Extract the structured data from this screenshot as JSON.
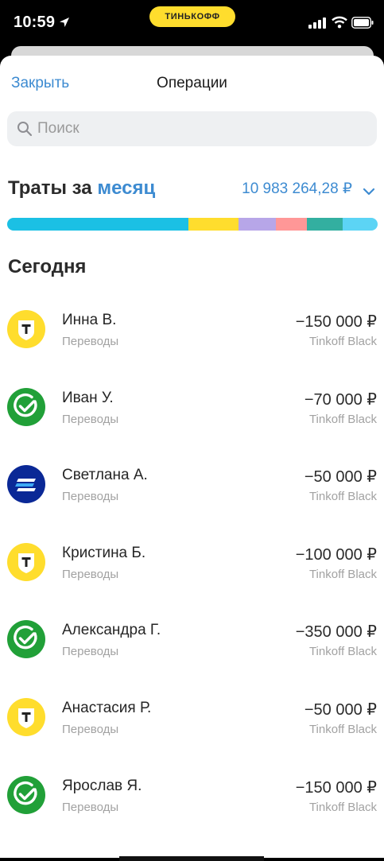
{
  "status_bar": {
    "time": "10:59",
    "brand": "ТИНЬКОФФ"
  },
  "header": {
    "close_label": "Закрыть",
    "title": "Операции"
  },
  "search": {
    "placeholder": "Поиск"
  },
  "spending": {
    "label": "Траты за",
    "period": "месяц",
    "total": "10 983 264,28 ₽",
    "segments": [
      {
        "color": "#1BC0E4",
        "fraction": 0.49
      },
      {
        "color": "#FFDD2D",
        "fraction": 0.135
      },
      {
        "color": "#B7A6E8",
        "fraction": 0.1
      },
      {
        "color": "#FF9797",
        "fraction": 0.085
      },
      {
        "color": "#33AFA0",
        "fraction": 0.095
      },
      {
        "color": "#5CD4F5",
        "fraction": 0.095
      }
    ]
  },
  "section_title": "Сегодня",
  "operations": [
    {
      "name": "Инна В.",
      "category": "Переводы",
      "amount": "−150 000 ₽",
      "card": "Tinkoff Black",
      "icon": "tinkoff-icon"
    },
    {
      "name": "Иван У.",
      "category": "Переводы",
      "amount": "−70 000 ₽",
      "card": "Tinkoff Black",
      "icon": "sber-icon"
    },
    {
      "name": "Светлана А.",
      "category": "Переводы",
      "amount": "−50 000 ₽",
      "card": "Tinkoff Black",
      "icon": "vtb-icon"
    },
    {
      "name": "Кристина Б.",
      "category": "Переводы",
      "amount": "−100 000 ₽",
      "card": "Tinkoff Black",
      "icon": "tinkoff-icon"
    },
    {
      "name": "Александра Г.",
      "category": "Переводы",
      "amount": "−350 000 ₽",
      "card": "Tinkoff Black",
      "icon": "sber-icon"
    },
    {
      "name": "Анастасия Р.",
      "category": "Переводы",
      "amount": "−50 000 ₽",
      "card": "Tinkoff Black",
      "icon": "tinkoff-icon"
    },
    {
      "name": "Ярослав Я.",
      "category": "Переводы",
      "amount": "−150 000 ₽",
      "card": "Tinkoff Black",
      "icon": "sber-icon"
    }
  ]
}
